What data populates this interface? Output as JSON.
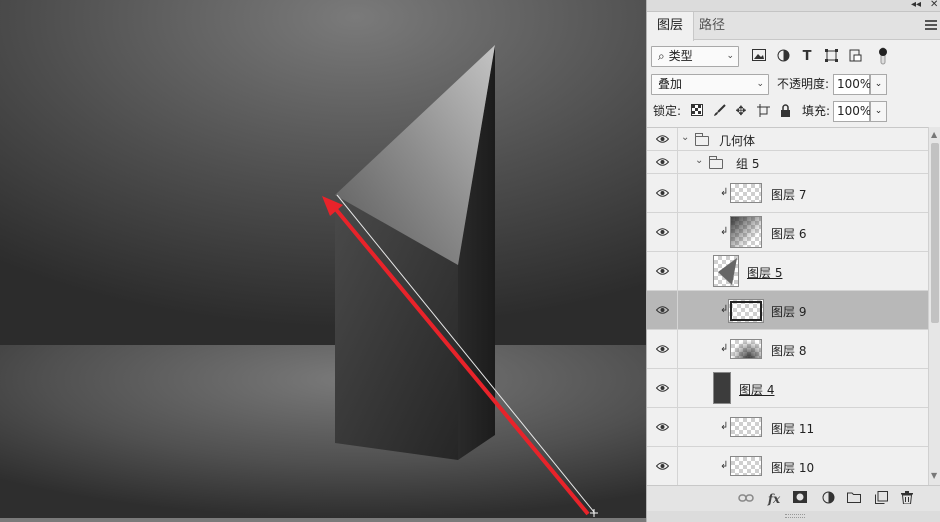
{
  "panel_header": {
    "collapse_label": "◂◂",
    "close_label": "✕"
  },
  "tabs": [
    {
      "label": "图层",
      "active": true
    },
    {
      "label": "路径",
      "active": false
    }
  ],
  "filter": {
    "kind_label": "类型",
    "kind_prefix": "⌕"
  },
  "blend": {
    "mode": "叠加",
    "opacity_label": "不透明度:",
    "opacity_value": "100%"
  },
  "lock": {
    "label": "锁定:",
    "fill_label": "填充:",
    "fill_value": "100%"
  },
  "layers": [
    {
      "name": "几何体",
      "type": "group",
      "expanded": true
    },
    {
      "name": "组 5",
      "type": "group",
      "expanded": true
    },
    {
      "name": "图层 7",
      "clipped": true
    },
    {
      "name": "图层 6",
      "clipped": true
    },
    {
      "name": "图层 5",
      "clipped": false
    },
    {
      "name": "图层 9",
      "clipped": true,
      "selected": true
    },
    {
      "name": "图层 8",
      "clipped": true
    },
    {
      "name": "图层 4",
      "clipped": false
    },
    {
      "name": "图层 11",
      "clipped": true
    },
    {
      "name": "图层 10",
      "clipped": true
    }
  ],
  "colors": {
    "canvas_bg": "#555555",
    "annotation_arrow": "#e8232a",
    "selection_row": "#b8b8b8",
    "panel_bg": "#f0f0f0"
  },
  "footer_icons": [
    "link-icon",
    "fx-icon",
    "mask-icon",
    "adjustment-icon",
    "folder-icon",
    "new-layer-icon",
    "trash-icon"
  ],
  "footer": {
    "fx_label": "fx"
  }
}
